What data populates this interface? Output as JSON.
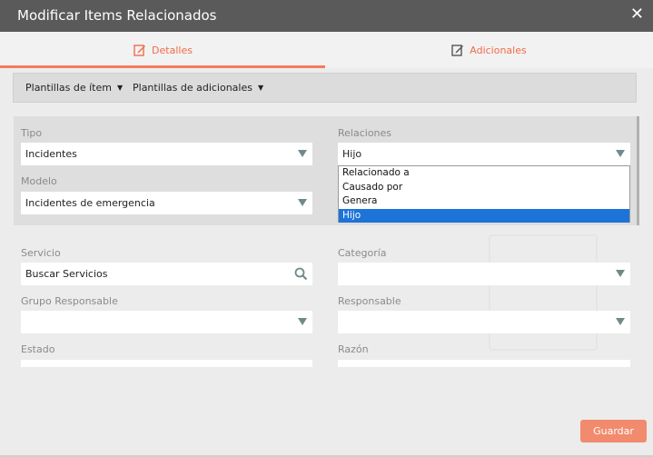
{
  "dialog": {
    "title": "Modificar Items Relacionados",
    "close_glyph": "✕"
  },
  "tabs": [
    {
      "label": "Detalles",
      "icon": "edit-icon",
      "active": true
    },
    {
      "label": "Adicionales",
      "icon": "edit-icon",
      "active": false
    }
  ],
  "templates": {
    "item_label": "Plantillas de ítem",
    "additional_label": "Plantillas de adicionales",
    "caret": "▼"
  },
  "form": {
    "tipo": {
      "label": "Tipo",
      "value": "Incidentes"
    },
    "relaciones": {
      "label": "Relaciones",
      "value": "Hijo",
      "options": [
        "Relacionado a",
        "Causado por",
        "Genera",
        "Hijo"
      ],
      "selected_index": 3
    },
    "modelo": {
      "label": "Modelo",
      "value": "Incidentes de emergencia"
    },
    "servicio": {
      "label": "Servicio",
      "placeholder": "Buscar Servicios"
    },
    "categoria": {
      "label": "Categoría",
      "value": ""
    },
    "grupo": {
      "label": "Grupo Responsable",
      "value": ""
    },
    "responsable": {
      "label": "Responsable",
      "value": ""
    },
    "estado": {
      "label": "Estado",
      "value": ""
    },
    "razon": {
      "label": "Razón",
      "value": ""
    }
  },
  "actions": {
    "save_label": "Guardar"
  },
  "colors": {
    "accent": "#f26b4a",
    "selected_option": "#1e73d8",
    "titlebar": "#5a5a5a"
  }
}
